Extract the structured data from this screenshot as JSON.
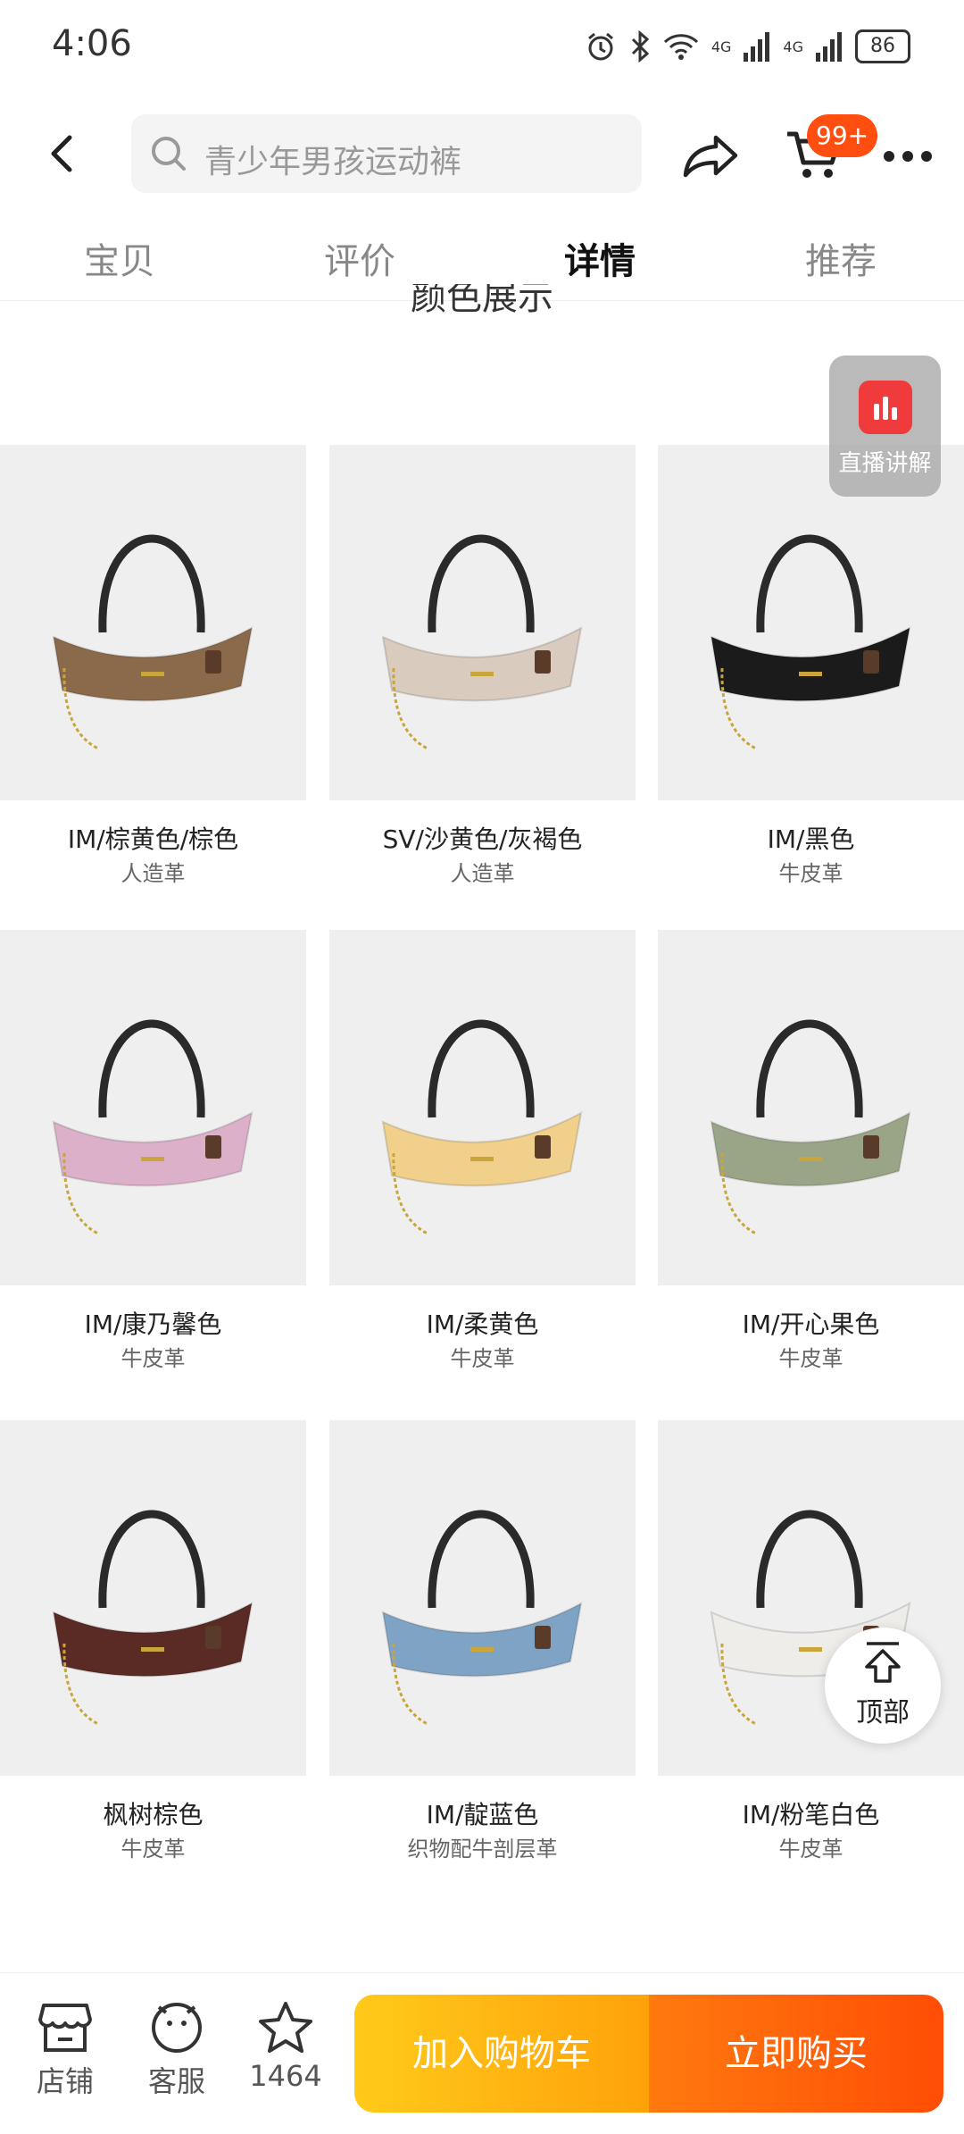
{
  "status_bar": {
    "time": "4:06",
    "network_1": "4G",
    "network_2": "4G",
    "battery": "86"
  },
  "header": {
    "search_placeholder": "青少年男孩运动裤",
    "cart_badge": "99+"
  },
  "tabs": [
    {
      "label": "宝贝",
      "active": false
    },
    {
      "label": "评价",
      "active": false
    },
    {
      "label": "详情",
      "active": true
    },
    {
      "label": "推荐",
      "active": false
    }
  ],
  "section_title": "颜色展示",
  "live_button": {
    "label": "直播讲解"
  },
  "products": [
    {
      "name": "IM/棕黄色/棕色",
      "material": "人造革",
      "bag_color": "#8a6a4b"
    },
    {
      "name": "SV/沙黄色/灰褐色",
      "material": "人造革",
      "bag_color": "#d9cbbd"
    },
    {
      "name": "IM/黑色",
      "material": "牛皮革",
      "bag_color": "#1b1b1b"
    },
    {
      "name": "IM/康乃馨色",
      "material": "牛皮革",
      "bag_color": "#ddb0c9"
    },
    {
      "name": "IM/柔黄色",
      "material": "牛皮革",
      "bag_color": "#f1d08c"
    },
    {
      "name": "IM/开心果色",
      "material": "牛皮革",
      "bag_color": "#9aa587"
    },
    {
      "name": "枫树棕色",
      "material": "牛皮革",
      "bag_color": "#5a2a24"
    },
    {
      "name": "IM/靛蓝色",
      "material": "织物配牛剖层革",
      "bag_color": "#7ea3c4"
    },
    {
      "name": "IM/粉笔白色",
      "material": "牛皮革",
      "bag_color": "#efedea"
    }
  ],
  "top_button": {
    "label": "顶部"
  },
  "bottom_bar": {
    "shop_label": "店铺",
    "service_label": "客服",
    "favorite_count": "1464",
    "add_to_cart": "加入购物车",
    "buy_now": "立即购买"
  }
}
